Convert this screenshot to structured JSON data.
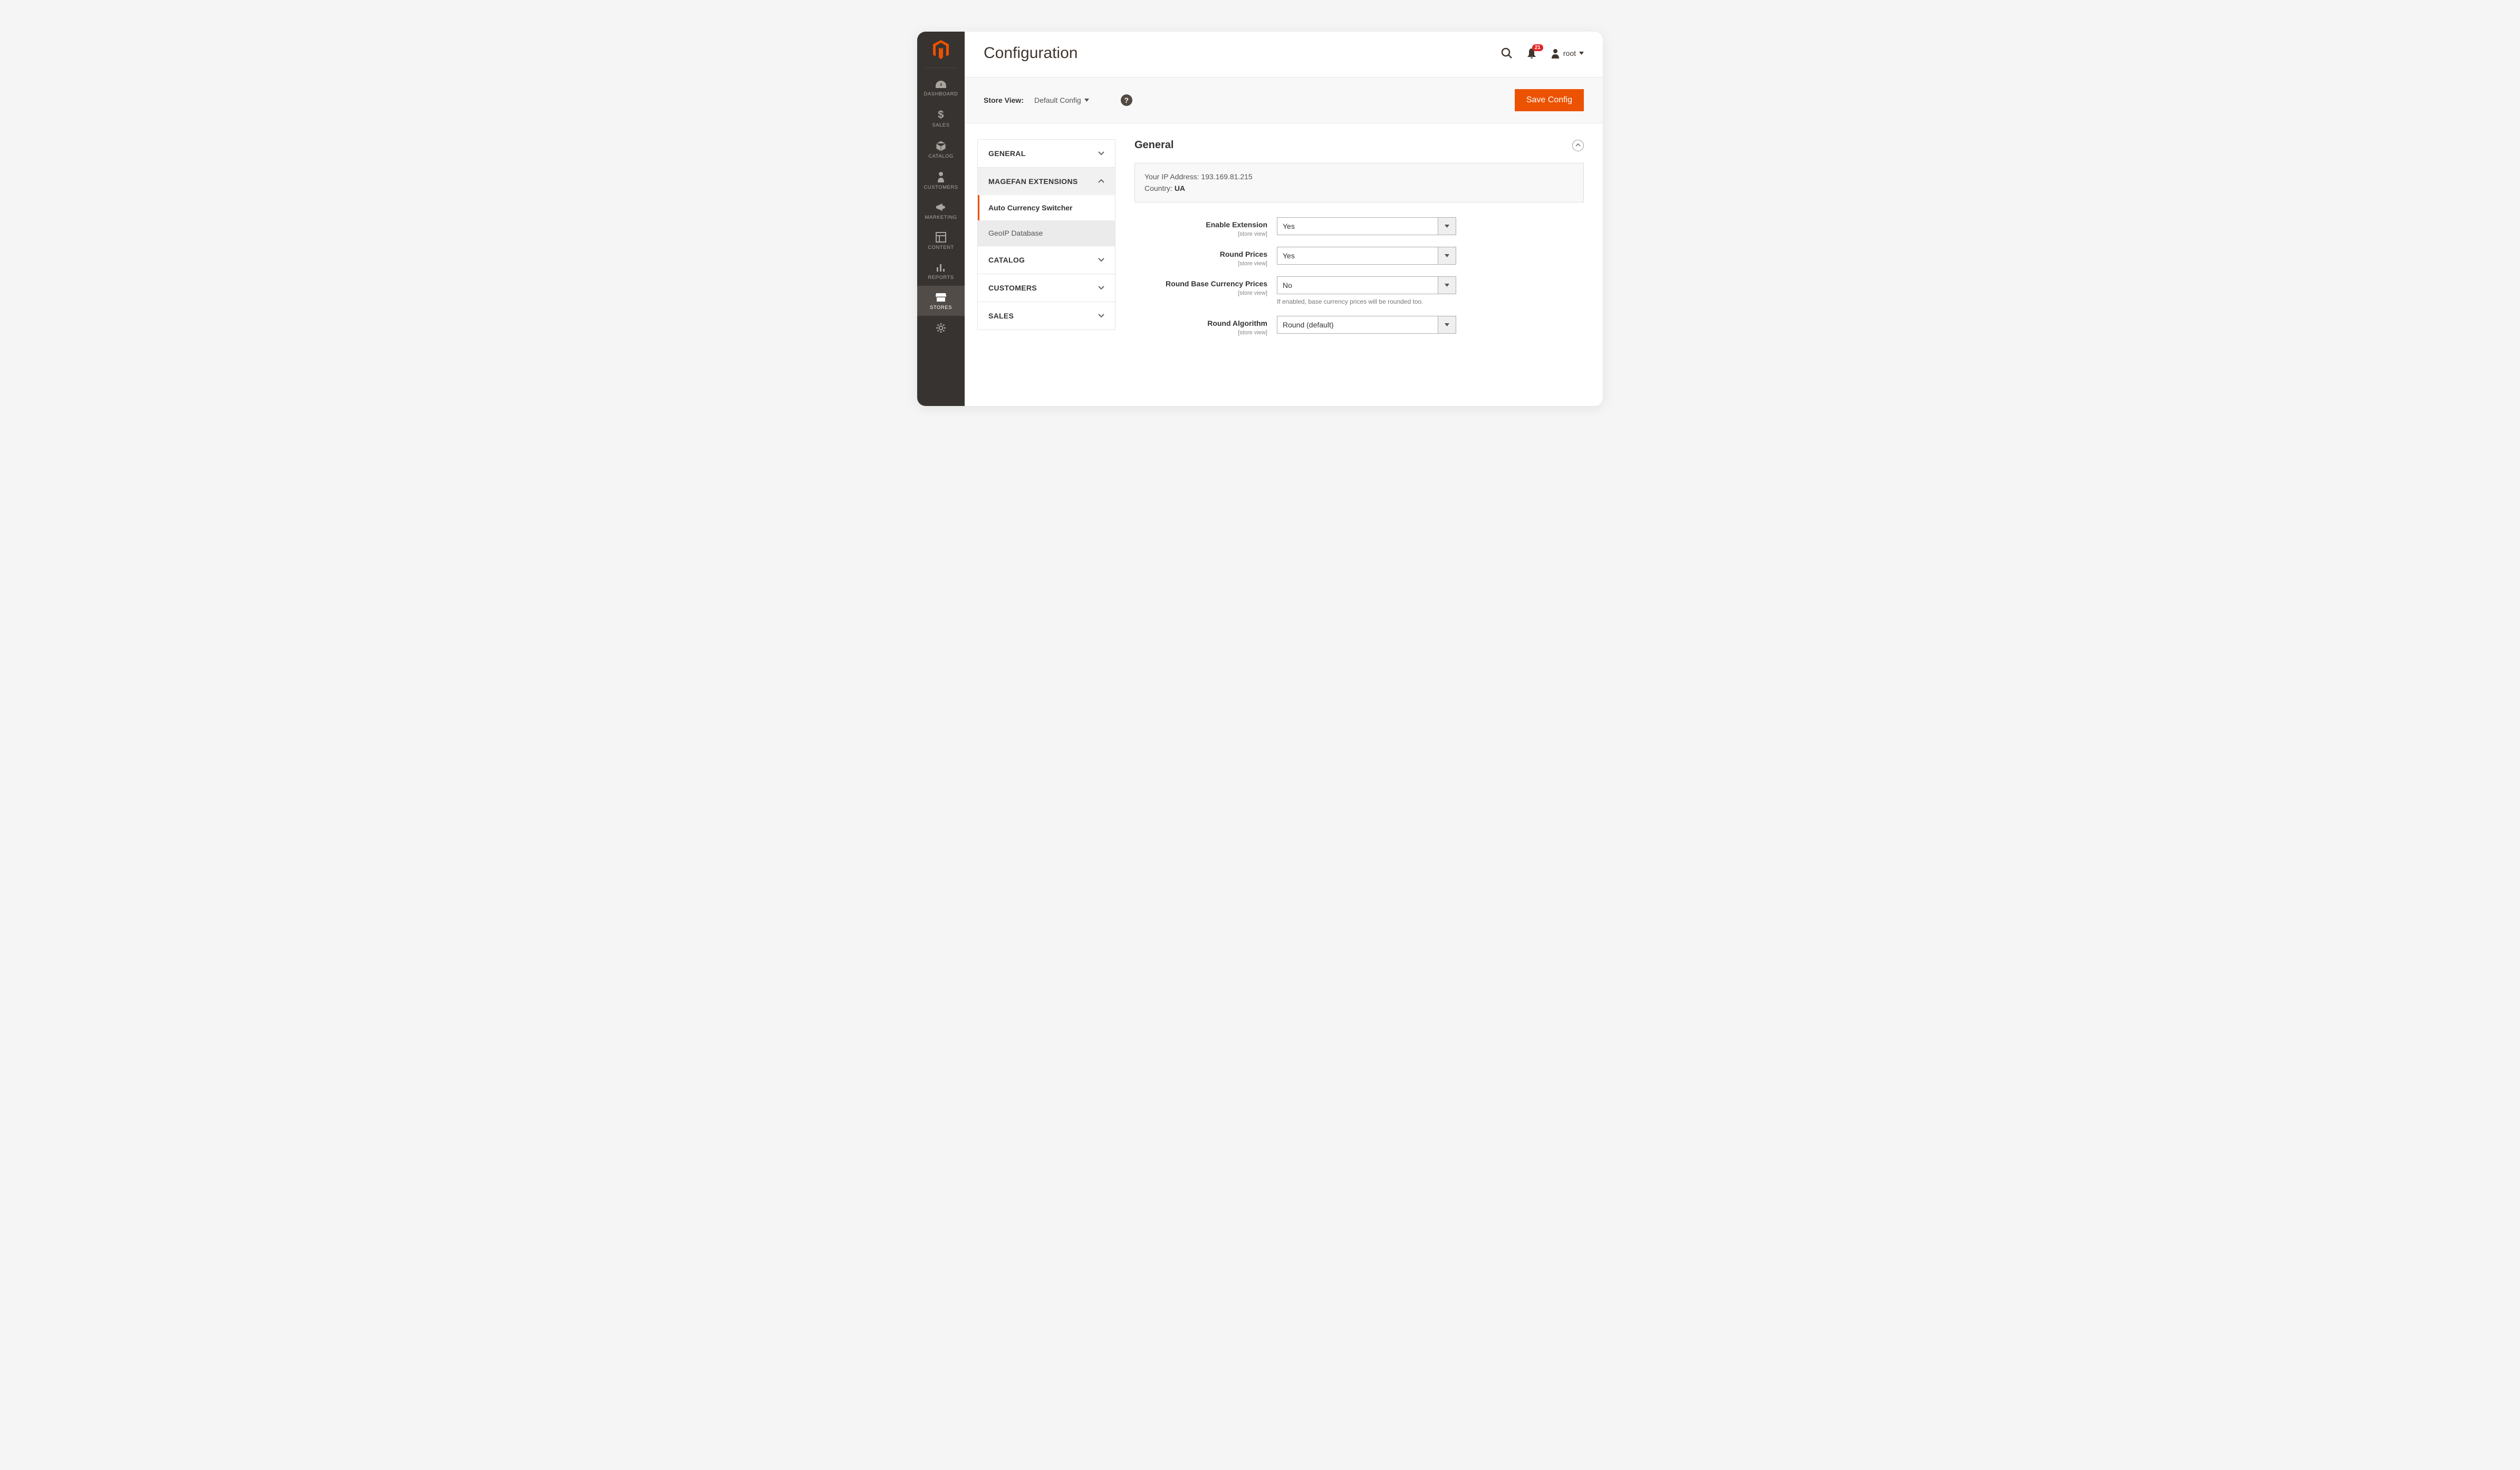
{
  "page_title": "Configuration",
  "header": {
    "notification_count": "21",
    "user_name": "root"
  },
  "toolbar": {
    "store_view_label": "Store View:",
    "store_view_value": "Default Config",
    "save_label": "Save Config"
  },
  "sidebar_nav": [
    {
      "label": "DASHBOARD"
    },
    {
      "label": "SALES"
    },
    {
      "label": "CATALOG"
    },
    {
      "label": "CUSTOMERS"
    },
    {
      "label": "MARKETING"
    },
    {
      "label": "CONTENT"
    },
    {
      "label": "REPORTS"
    },
    {
      "label": "STORES"
    }
  ],
  "config_sections": {
    "general": "GENERAL",
    "magefan": "MAGEFAN EXTENSIONS",
    "magefan_items": {
      "auto_currency": "Auto Currency Switcher",
      "geoip": "GeoIP Database"
    },
    "catalog": "CATALOG",
    "customers": "CUSTOMERS",
    "sales": "SALES"
  },
  "section_title": "General",
  "info": {
    "ip_label": "Your IP Address: ",
    "ip_value": "193.169.81.215",
    "country_label": "Country: ",
    "country_value": "UA"
  },
  "fields": {
    "enable": {
      "label": "Enable Extension",
      "scope": "[store view]",
      "value": "Yes"
    },
    "round_prices": {
      "label": "Round Prices",
      "scope": "[store view]",
      "value": "Yes"
    },
    "round_base": {
      "label": "Round Base Currency Prices",
      "scope": "[store view]",
      "value": "No",
      "help": "If enabled, base currency prices will be rounded too."
    },
    "round_algo": {
      "label": "Round Algorithm",
      "scope": "[store view]",
      "value": "Round (default)"
    }
  }
}
